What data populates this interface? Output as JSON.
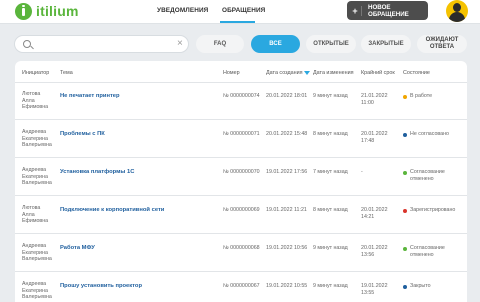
{
  "app": {
    "logo_text": "itilium"
  },
  "nav": {
    "notifications": "УВЕДОМЛЕНИЯ",
    "requests": "ОБРАЩЕНИЯ"
  },
  "new_request_button": {
    "plus": "+",
    "label": "НОВОЕ ОБРАЩЕНИЕ"
  },
  "search": {
    "placeholder": "",
    "clear": "×"
  },
  "filters": [
    {
      "label": "FAQ"
    },
    {
      "label": "ВСЕ"
    },
    {
      "label": "ОТКРЫТЫЕ"
    },
    {
      "label": "ЗАКРЫТЫЕ"
    },
    {
      "label": "ОЖИДАЮТ ОТВЕТА"
    }
  ],
  "colors": {
    "accent": "#2aa8e0",
    "brand": "#5ab53c",
    "link": "#1f5f9e",
    "in_progress": "#f0a500",
    "not_agreed": "#1f5f9e",
    "agreement_cancelled": "#5ab53c",
    "registered": "#d9342b",
    "closed": "#1f5f9e"
  },
  "table": {
    "headers": {
      "initiator": "Инициатор",
      "topic": "Тема",
      "number": "Номер",
      "created": "Дата создания",
      "changed": "Дата изменения",
      "deadline": "Крайний срок",
      "status": "Состояние"
    },
    "rows": [
      {
        "initiator": [
          "Лютова",
          "Алла",
          "Ефимовна"
        ],
        "topic": "Не печатает принтер",
        "number": "№ 0000000074",
        "created": "20.01.2022 18:01",
        "changed": "9 минут назад",
        "deadline": [
          "21.01.2022",
          "11:00"
        ],
        "status": [
          "В работе"
        ],
        "status_color": "#f0a500"
      },
      {
        "initiator": [
          "Андреева",
          "Екатерина",
          "Валерьевна"
        ],
        "topic": "Проблемы с ПК",
        "number": "№ 0000000071",
        "created": "20.01.2022 15:48",
        "changed": "8 минут назад",
        "deadline": [
          "20.01.2022",
          "17:48"
        ],
        "status": [
          "Не согласовано"
        ],
        "status_color": "#1f5f9e"
      },
      {
        "initiator": [
          "Андреева",
          "Екатерина",
          "Валерьевна"
        ],
        "topic": "Установка платформы 1С",
        "number": "№ 0000000070",
        "created": "19.01.2022 17:56",
        "changed": "7 минут назад",
        "deadline": [
          "-"
        ],
        "status": [
          "Согласование",
          "отменено"
        ],
        "status_color": "#5ab53c"
      },
      {
        "initiator": [
          "Лютова",
          "Алла",
          "Ефимовна"
        ],
        "topic": "Подключение к корпоративной сети",
        "number": "№ 0000000069",
        "created": "19.01.2022 11:21",
        "changed": "8 минут назад",
        "deadline": [
          "20.01.2022",
          "14:21"
        ],
        "status": [
          "Зарегистрировано"
        ],
        "status_color": "#d9342b"
      },
      {
        "initiator": [
          "Андреева",
          "Екатерина",
          "Валерьевна"
        ],
        "topic": "Работа МФУ",
        "number": "№ 0000000068",
        "created": "19.01.2022 10:56",
        "changed": "9 минут назад",
        "deadline": [
          "20.01.2022",
          "13:56"
        ],
        "status": [
          "Согласование",
          "отменено"
        ],
        "status_color": "#5ab53c"
      },
      {
        "initiator": [
          "Андреева",
          "Екатерина",
          "Валерьевна"
        ],
        "topic": "Прошу установить проектор",
        "number": "№ 0000000067",
        "created": "19.01.2022 10:55",
        "changed": "9 минут назад",
        "deadline": [
          "19.01.2022",
          "13:55"
        ],
        "status": [
          "Закрыто"
        ],
        "status_color": "#1f5f9e"
      }
    ]
  }
}
